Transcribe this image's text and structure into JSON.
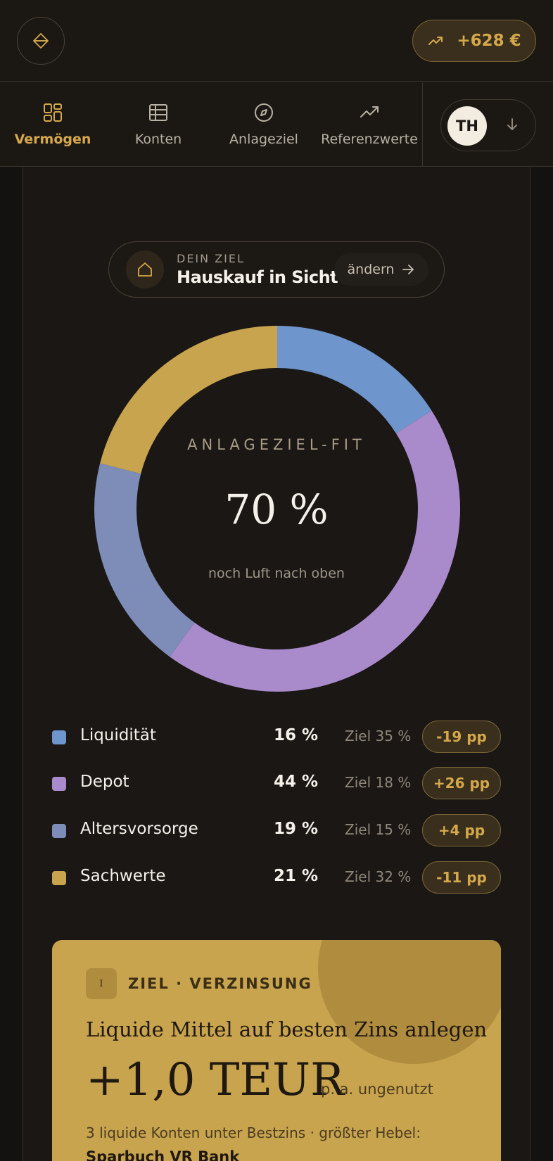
{
  "header": {
    "gain_value": "+628 €"
  },
  "nav": {
    "items": [
      {
        "label": "Vermögen",
        "icon": "grid-icon",
        "active": true
      },
      {
        "label": "Konten",
        "icon": "table-icon",
        "active": false
      },
      {
        "label": "Anlageziel",
        "icon": "compass-icon",
        "active": false
      },
      {
        "label": "Referenzwerte",
        "icon": "trending-up-icon",
        "active": false
      }
    ],
    "user_initials": "TH"
  },
  "goal": {
    "kicker": "DEIN ZIEL",
    "title": "Hauskauf in Sicht",
    "change_label": "ändern"
  },
  "donut": {
    "label": "ANLAGEZIEL-FIT",
    "value": "70 %",
    "subtitle": "noch Luft nach oben"
  },
  "chart_data": {
    "type": "pie",
    "categories": [
      "Liquidität",
      "Depot",
      "Altersvorsorge",
      "Sachwerte"
    ],
    "values": [
      16,
      44,
      19,
      21
    ],
    "colors": [
      "#6e95cc",
      "#a98acb",
      "#7e8cb8",
      "#c9a44e"
    ]
  },
  "allocation": [
    {
      "name": "Liquidität",
      "percent": "16 %",
      "target": "Ziel 35 %",
      "delta": "-19 pp",
      "color": "#6e95cc"
    },
    {
      "name": "Depot",
      "percent": "44 %",
      "target": "Ziel 18 %",
      "delta": "+26 pp",
      "color": "#a98acb"
    },
    {
      "name": "Altersvorsorge",
      "percent": "19 %",
      "target": "Ziel 15 %",
      "delta": "+4 pp",
      "color": "#7e8cb8"
    },
    {
      "name": "Sachwerte",
      "percent": "21 %",
      "target": "Ziel 32 %",
      "delta": "-11 pp",
      "color": "#c9a44e"
    }
  ],
  "card": {
    "badge": "I",
    "kicker": "ZIEL · VERZINSUNG",
    "headline": "Liquide Mittel auf besten Zins anlegen",
    "amount": "+1,0 TEUR",
    "unit": "p. a. ungenutzt",
    "description": "3 liquide Konten unter Bestzins · größter Hebel:",
    "account": "Sparbuch VR Bank"
  },
  "colors": {
    "accent": "#d5a84b",
    "background": "#141210",
    "card": "#c9a44e"
  }
}
